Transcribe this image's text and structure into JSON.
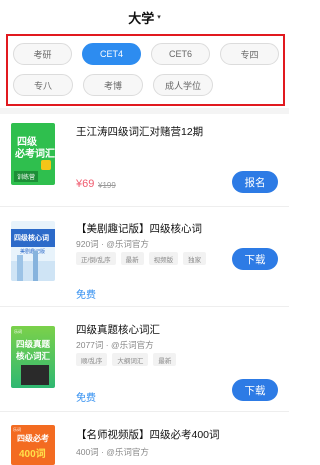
{
  "header": {
    "title": "大学",
    "caret": "▾"
  },
  "filters": {
    "row1": [
      {
        "label": "考研",
        "active": false
      },
      {
        "label": "CET4",
        "active": true
      },
      {
        "label": "CET6",
        "active": false
      },
      {
        "label": "专四",
        "active": false
      }
    ],
    "row2": [
      {
        "label": "专八",
        "active": false
      },
      {
        "label": "考博",
        "active": false
      },
      {
        "label": "成人学位",
        "active": false
      }
    ]
  },
  "items": [
    {
      "title": "王江涛四级词汇对赌营12期",
      "price": "¥69",
      "price_old": "¥199",
      "button": "报名",
      "cover": {
        "line1": "四级",
        "line2": "必考词汇",
        "label": "训练营"
      }
    },
    {
      "title": "【美剧趣记版】四级核心词",
      "meta": "920词 · @乐词官方",
      "tags": [
        "正/倒/乱序",
        "最新",
        "视频版",
        "独家"
      ],
      "free": "免费",
      "button": "下载",
      "cover": {
        "line1": "四级核心词",
        "line2": "美剧趣记版"
      }
    },
    {
      "title": "四级真题核心词汇",
      "meta": "2077词 · @乐词官方",
      "tags": [
        "顺/乱序",
        "大纲词汇",
        "最新"
      ],
      "free": "免费",
      "button": "下载",
      "cover": {
        "line1": "四级真题",
        "line2": "核心词汇",
        "tiny": "乐词"
      }
    },
    {
      "title": "【名师视频版】四级必考400词",
      "meta": "400词 · @乐词官方",
      "cover": {
        "line1": "四级必考",
        "line2": "400词",
        "tiny": "乐词"
      }
    }
  ],
  "colors": {
    "accent": "#2d7be5",
    "highlight_border": "#e1191f",
    "price": "#f05a6e"
  }
}
